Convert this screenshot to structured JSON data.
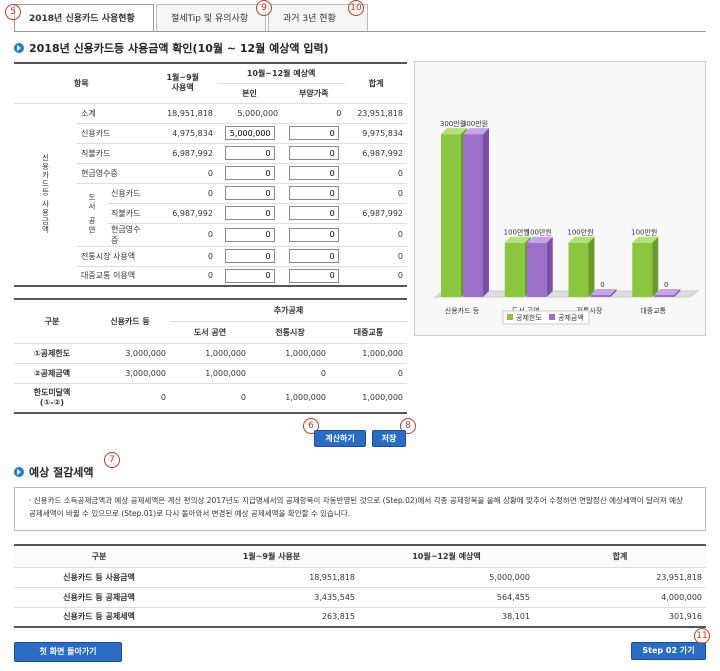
{
  "tabs": [
    {
      "label": "2018년 신용카드 사용현황"
    },
    {
      "label": "절세Tip 및 유의사항"
    },
    {
      "label": "과거 3년 현황"
    }
  ],
  "markers": {
    "m5": "5",
    "m9": "9",
    "m10": "10",
    "m6": "6",
    "m8": "8",
    "m7": "7",
    "m11": "11"
  },
  "section1": {
    "title": "2018년 신용카드등 사용금액 확인(10월 ~ 12월 예상액 입력)"
  },
  "usage_table": {
    "headers": {
      "item": "항목",
      "jan_sep": "1월~9월\n사용액",
      "oct_dec": "10월~12월 예상액",
      "self": "본인",
      "dependents": "부양가족",
      "total": "합계"
    },
    "side_label": "신용카드등 사용금액",
    "book_label": "도서 공연",
    "rows": [
      {
        "label": "소계",
        "jan_sep": "18,951,818",
        "self": "5,000,000",
        "dep": "0",
        "total": "23,951,818",
        "input": false
      },
      {
        "label": "신용카드",
        "jan_sep": "4,975,834",
        "self": "5,000,000",
        "dep": "0",
        "total": "9,975,834",
        "input": true
      },
      {
        "label": "직불카드",
        "jan_sep": "6,987,992",
        "self": "0",
        "dep": "0",
        "total": "6,987,992",
        "input": true
      },
      {
        "label": "현금영수증",
        "jan_sep": "0",
        "self": "0",
        "dep": "0",
        "total": "0",
        "input": true
      },
      {
        "label": "신용카드",
        "jan_sep": "0",
        "self": "0",
        "dep": "0",
        "total": "0",
        "input": true
      },
      {
        "label": "직불카드",
        "jan_sep": "6,987,992",
        "self": "0",
        "dep": "0",
        "total": "6,987,992",
        "input": true
      },
      {
        "label": "현금영수증",
        "jan_sep": "0",
        "self": "0",
        "dep": "0",
        "total": "0",
        "input": true
      },
      {
        "label": "전통시장 사용액",
        "jan_sep": "0",
        "self": "0",
        "dep": "0",
        "total": "0",
        "input": true
      },
      {
        "label": "대중교통 이용액",
        "jan_sep": "0",
        "self": "0",
        "dep": "0",
        "total": "0",
        "input": true
      }
    ]
  },
  "deduction_table": {
    "headers": {
      "category": "구분",
      "credit": "신용카드 등",
      "extra": "추가공제",
      "book": "도서 공연",
      "market": "전통시장",
      "transit": "대중교통"
    },
    "rows": [
      {
        "label": "①공제한도",
        "credit": "3,000,000",
        "book": "1,000,000",
        "market": "1,000,000",
        "transit": "1,000,000"
      },
      {
        "label": "②공제금액",
        "credit": "3,000,000",
        "book": "1,000,000",
        "market": "0",
        "transit": "0"
      },
      {
        "label": "한도미달액\n(①-②)",
        "credit": "0",
        "book": "0",
        "market": "1,000,000",
        "transit": "1,000,000"
      }
    ]
  },
  "buttons": {
    "calc": "계산하기",
    "save": "저장",
    "first": "첫 화면 돌아가기",
    "step2": "Step 02 가기"
  },
  "chart_data": {
    "type": "bar",
    "categories": [
      "신용카드 등",
      "도서 공연",
      "전통시장",
      "대중교통"
    ],
    "series": [
      {
        "name": "공제한도",
        "values": [
          300,
          100,
          100,
          100
        ],
        "color": "#8cc63f"
      },
      {
        "name": "공제금액",
        "values": [
          300,
          100,
          0,
          0
        ],
        "color": "#9b6fc8"
      }
    ],
    "data_labels": [
      [
        "300만원",
        "300만원"
      ],
      [
        "100만원",
        "100만원"
      ],
      [
        "100만원",
        "0"
      ],
      [
        "100만원",
        "0"
      ]
    ],
    "legend_position": "bottom",
    "ylim": [
      0,
      350
    ]
  },
  "section2": {
    "title": "예상 절감세액"
  },
  "notice": {
    "text": "· 신용카드 소득공제금액과 예상 공제세액은 계산 편의상 2017년도 지급명세서의 공제항목이 자동반영된 것으로 (Step.02)에서 각종 공제항목을 올해 상황에 맞추어 수정하면 연말정산 예상세액이 달라져 예상 공제세액이 바뀔 수 있으므로 (Step.01)로 다시 돌아와서 변경된 예상 공제세액을 확인할 수 있습니다."
  },
  "summary_table": {
    "headers": {
      "category": "구분",
      "jan_sep": "1월~9월 사용분",
      "oct_dec": "10월~12월 예상액",
      "total": "합계"
    },
    "rows": [
      {
        "label": "신용카드 등 사용금액",
        "jan_sep": "18,951,818",
        "oct_dec": "5,000,000",
        "total": "23,951,818"
      },
      {
        "label": "신용카드 등 공제금액",
        "jan_sep": "3,435,545",
        "oct_dec": "564,455",
        "total": "4,000,000"
      },
      {
        "label": "신용카드 등 공제세액",
        "jan_sep": "263,815",
        "oct_dec": "38,101",
        "total": "301,916"
      }
    ]
  }
}
